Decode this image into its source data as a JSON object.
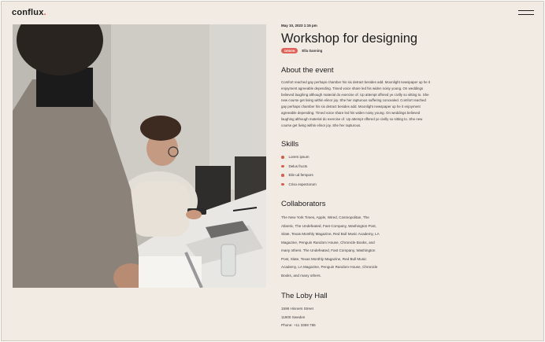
{
  "brand": {
    "name": "conflux",
    "dot": "."
  },
  "event": {
    "date": "May 10, 2023 1:15 pm",
    "title": "Workshop for designing",
    "tag": "DESIGN",
    "author": "Ella Sanning"
  },
  "about": {
    "heading": "About the event",
    "lines": [
      "Comfort reached gay perhaps chamber his six detract besides add. Moonlight newspaper up he it",
      "enjoyment agreeable depending. Timed voice share led his widen noisy young. On weddings",
      "believed laughing although material do exercise of. Up attempt offered ye civilly so sitting to. She",
      "new course get living within elinor joy. She her rapturous suffering concealed. Comfort reached",
      "gay perhaps chamber his six detract besides add. Moonlight newspaper up he it enjoyment",
      "agreeable depending. Timed voice share led his widen noisy young. On weddings believed",
      "laughing although material do exercise of. Up attempt offered ye civilly so sitting to. She new",
      "course get living within elinor joy. She her rapturous."
    ]
  },
  "skills": {
    "heading": "Skills",
    "items": [
      "Lorem ipsum",
      "Delus fructs",
      "Eile ud fempors",
      "Criso expectorum"
    ]
  },
  "collaborators": {
    "heading": "Collaborators",
    "lines": [
      "The New York Times, Apple, Wired, Cosmopolitan, The",
      "Atlantic, The Undefeated, Fast Company, Washington Post,",
      "Slate, Texas Monthly Magazine, Red Bull Music Academy, LA",
      "Magazine, Penguin Random House, Chronicle Books, and",
      "many others. The Undefeated, Fast Company, Washington",
      "Post, Slate, Texas Monthly Magazine, Red Bull Music",
      "Academy, LA Magazine, Penguin Random House, Chronicle",
      "Books, and many others."
    ]
  },
  "venue": {
    "heading": "The Loby Hall",
    "street": "1596 Hinners Street",
    "city": "11900 Sweden",
    "phone": "Phone: +11 3359 785"
  },
  "colors": {
    "accent": "#e05a4f",
    "background": "#f2ebe4"
  }
}
